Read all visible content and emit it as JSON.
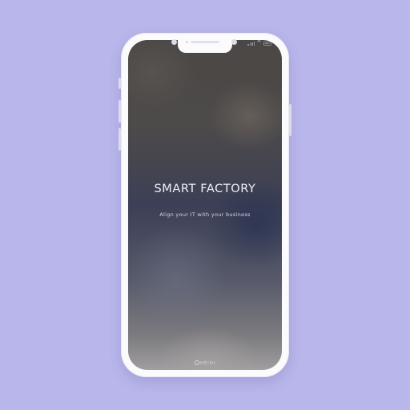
{
  "colors": {
    "background": "#b8b6ea",
    "device_frame": "#fbfbfd",
    "title_text": "#f1f1f5"
  },
  "device": {
    "status_icons": [
      "signal-icon",
      "wifi-icon",
      "battery-icon"
    ]
  },
  "splash": {
    "title": "SMART FACTORY",
    "subtitle": "Align your IT with your business",
    "brand": "HEIDI",
    "brand_icon": "heidi-logo-icon"
  }
}
